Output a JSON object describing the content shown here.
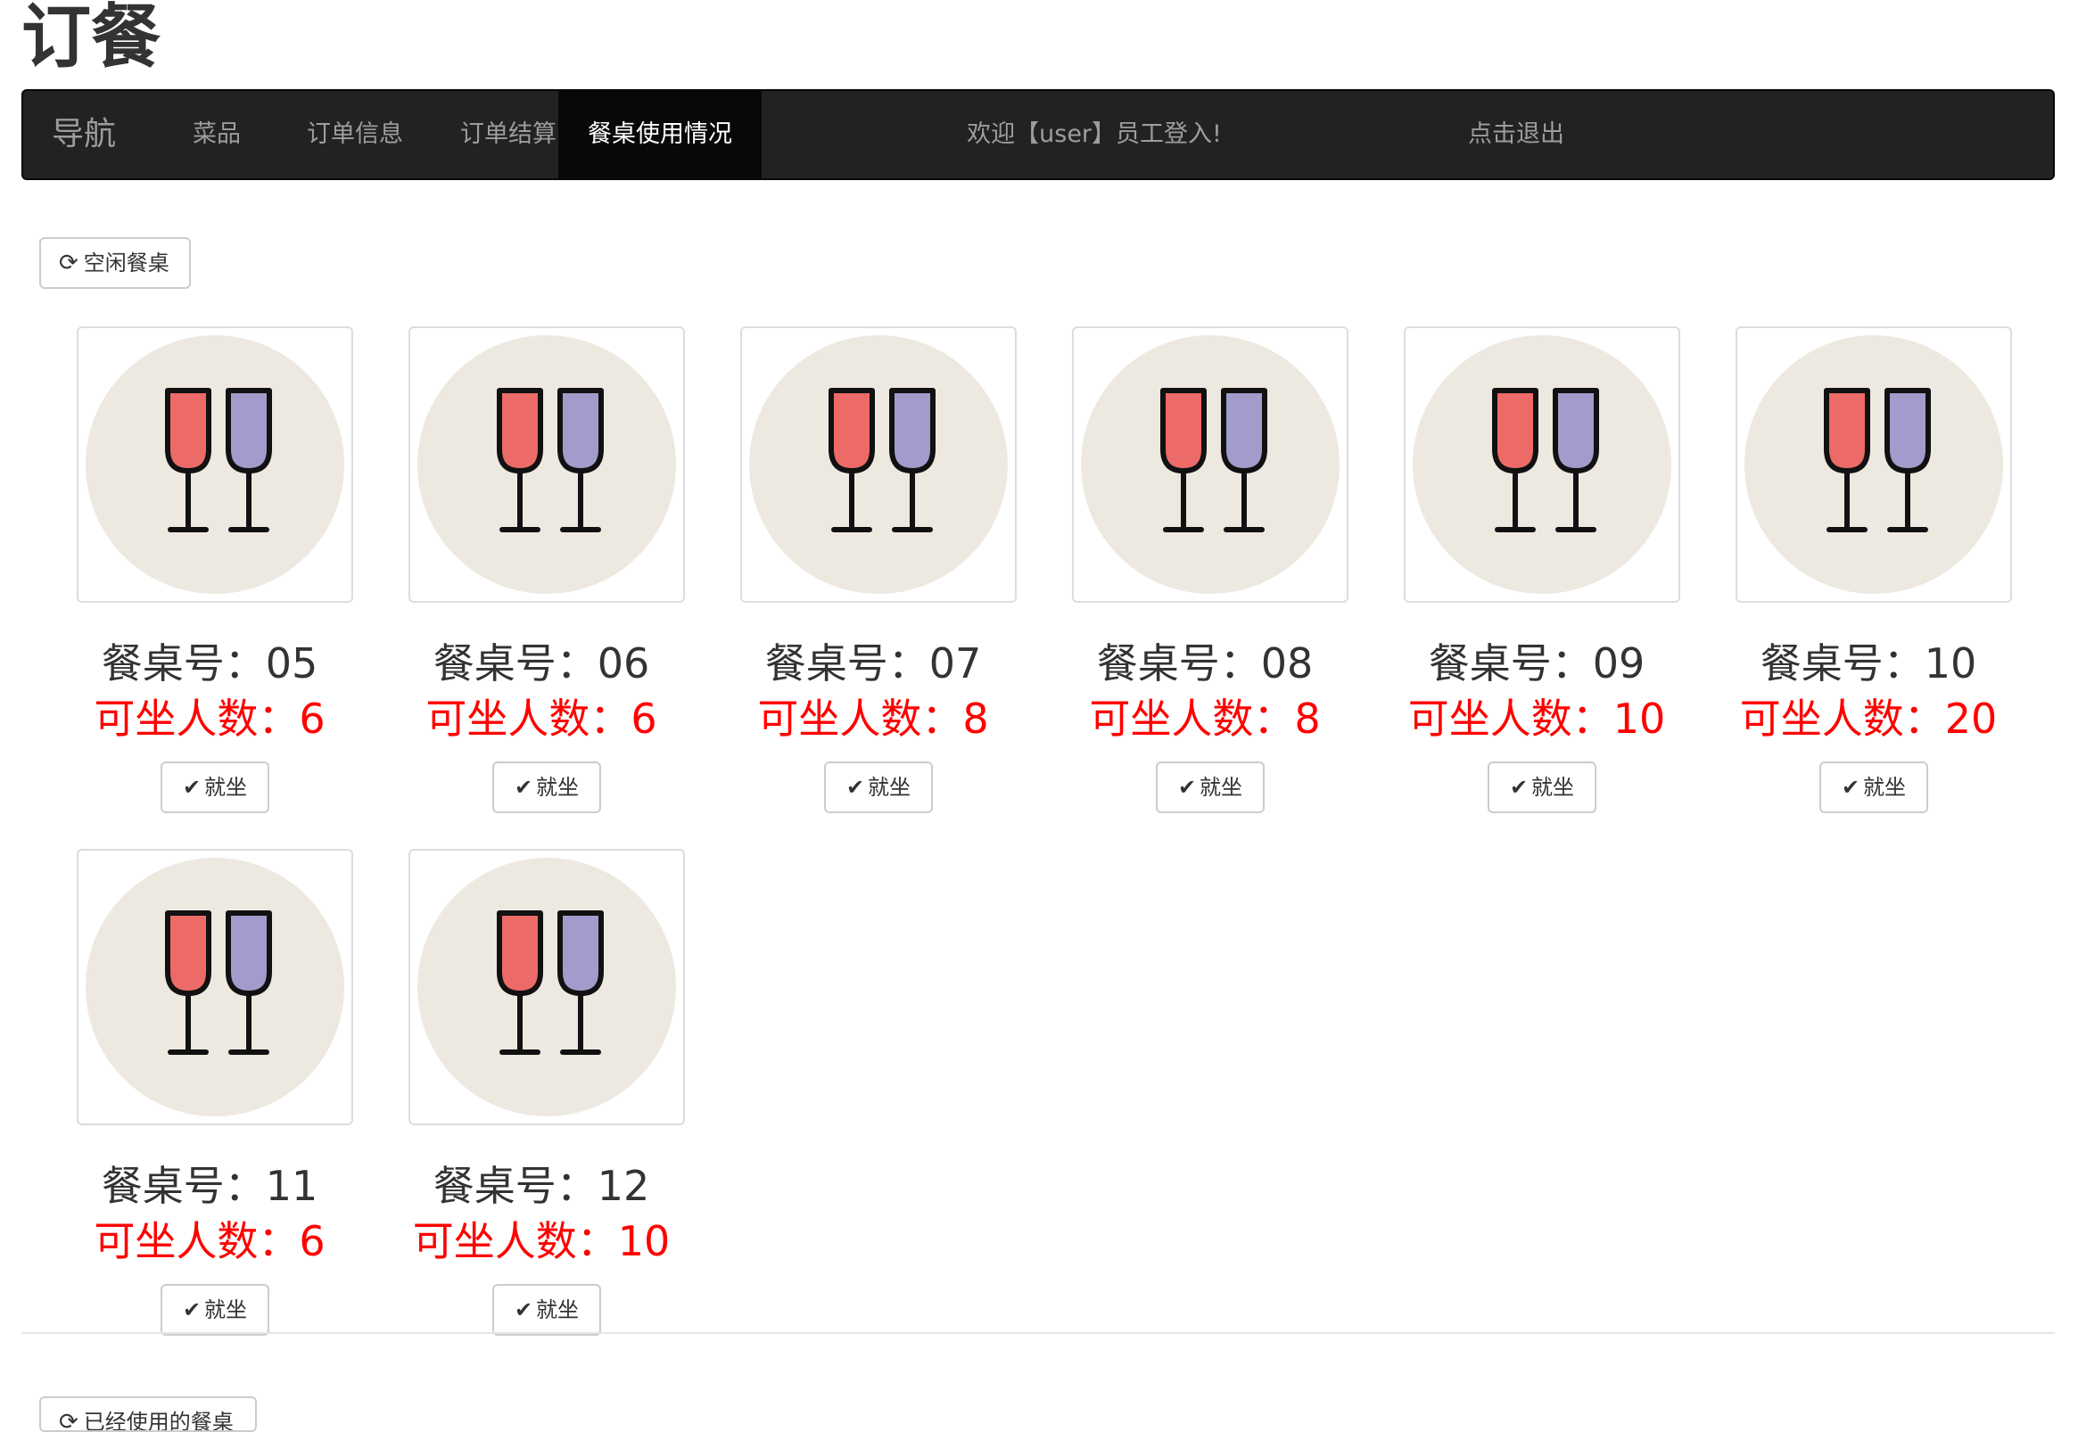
{
  "app_title": "订餐",
  "nav": {
    "brand": "导航",
    "items": [
      "菜品",
      "订单信息",
      "订单结算",
      "餐桌使用情况"
    ],
    "welcome": "欢迎【user】员工登入!",
    "logout": "点击退出"
  },
  "free_section": {
    "button_label": "空闲餐桌",
    "icon": "refresh-icon"
  },
  "tables": [
    {
      "table_label": "餐桌号：05",
      "capacity_label": "可坐人数：6",
      "seat_label": "就坐"
    },
    {
      "table_label": "餐桌号：06",
      "capacity_label": "可坐人数：6",
      "seat_label": "就坐"
    },
    {
      "table_label": "餐桌号：07",
      "capacity_label": "可坐人数：8",
      "seat_label": "就坐"
    },
    {
      "table_label": "餐桌号：08",
      "capacity_label": "可坐人数：8",
      "seat_label": "就坐"
    },
    {
      "table_label": "餐桌号：09",
      "capacity_label": "可坐人数：10",
      "seat_label": "就坐"
    },
    {
      "table_label": "餐桌号：10",
      "capacity_label": "可坐人数：20",
      "seat_label": "就坐"
    },
    {
      "table_label": "餐桌号：11",
      "capacity_label": "可坐人数：6",
      "seat_label": "就坐"
    },
    {
      "table_label": "餐桌号：12",
      "capacity_label": "可坐人数：10",
      "seat_label": "就坐"
    }
  ],
  "used_section": {
    "button_label": "已经使用的餐桌",
    "icon": "refresh-icon"
  },
  "icons": {
    "table_image": "wine-glasses-icon",
    "seat_button": "check-icon"
  },
  "colors": {
    "navbar_bg": "#222222",
    "navbar_active_bg": "#080808",
    "capacity_text": "#ff0000",
    "glass_left": "#ec6b68",
    "glass_right": "#a29bcb",
    "image_circle": "#ede9e1"
  }
}
